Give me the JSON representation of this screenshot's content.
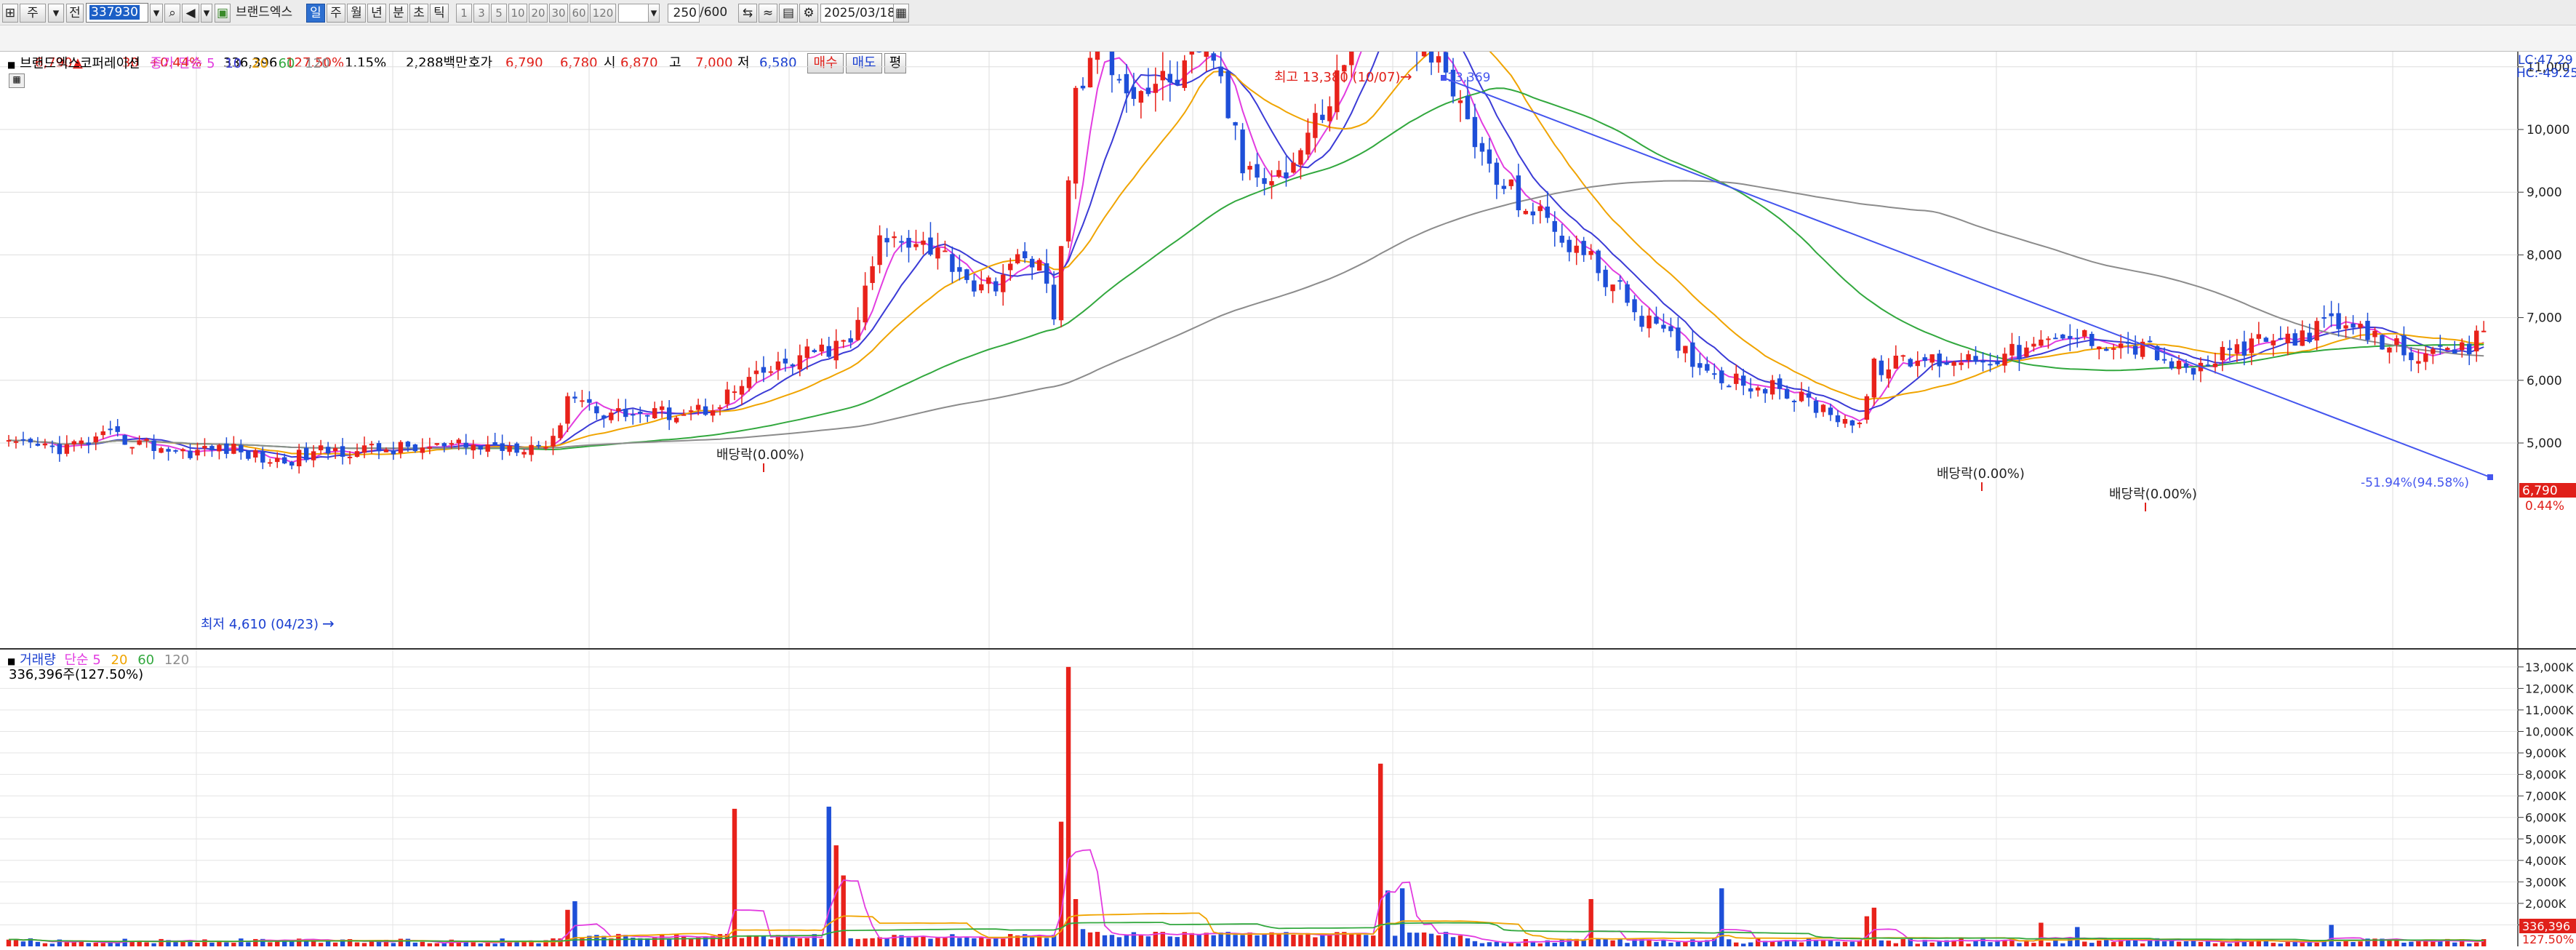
{
  "toolbar": {
    "type_selector": "주",
    "mode_selector": "전",
    "stock_code": "337930",
    "stock_name": "브랜드엑스",
    "period_tabs": [
      "일",
      "주",
      "월",
      "년",
      "분",
      "초",
      "틱"
    ],
    "active_period": "일",
    "interval_buttons": [
      "1",
      "3",
      "5",
      "10",
      "20",
      "30",
      "60",
      "120"
    ],
    "count_display": "250",
    "count_total": "/600",
    "date": "2025/03/18"
  },
  "quote": {
    "price": "6,790",
    "change_sign": "▲",
    "change": "30",
    "change_pct": "+0.44%",
    "volume": "336,396",
    "volume_ratio": "127.50%",
    "turnover": "1.15%",
    "trade_value": "2,288백만",
    "hoga_label": "호가",
    "ask": "6,790",
    "bid": "6,780",
    "open_label": "시",
    "open": "6,870",
    "high_label": "고",
    "high": "7,000",
    "low_label": "저",
    "low": "6,580",
    "buy_button": "매수",
    "sell_button": "매도",
    "eval_button": "평"
  },
  "price_panel": {
    "stock_label": "브랜드엑스코퍼레이션",
    "ma_label": "종가 단순",
    "ma_periods": [
      "5",
      "10",
      "20",
      "60",
      "120"
    ],
    "lc_label": "LC:47.29",
    "hc_label": "HC:-49.25",
    "current_price_tag": "6,790",
    "current_pct_tag": "0.44%",
    "high_annotation": "최고 13,380 (10/07)",
    "low_annotation": "최저 4,610 (04/23)",
    "trendline_start_label": "13,369",
    "trendline_end_label": "-51.94%(94.58%)",
    "dividend_labels": [
      "배당락(0.00%)",
      "배당락(0.00%)",
      "배당락(0.00%)"
    ]
  },
  "volume_panel": {
    "label": "거래량",
    "ma_label": "단순",
    "ma_periods": [
      "5",
      "20",
      "60",
      "120"
    ],
    "volume_value": "336,396주(127.50%)",
    "current_tag": "336,396",
    "current_tag2": "127.50%"
  },
  "colors": {
    "up": "#e8221b",
    "down": "#1e4fd8",
    "ma5": "#e23ce0",
    "ma10": "#3b3bd6",
    "ma20": "#f0a400",
    "ma60": "#32a83e",
    "ma120": "#8c8c8c",
    "trend": "#4455ee"
  },
  "chart_data": [
    {
      "type": "candlestick",
      "title": "브랜드엑스코퍼레이션",
      "ylim": [
        4500,
        13600
      ],
      "y_ticks": [
        5000,
        6000,
        7000,
        8000,
        9000,
        10000,
        11000,
        12000,
        13000
      ],
      "y_tick_labels": [
        "5,000",
        "6,000",
        "7,000",
        "8,000",
        "9,000",
        "10,000",
        "11,000",
        "12,000",
        "13,000"
      ],
      "y_scale": "linear",
      "grid": true,
      "high_point": {
        "date": "10/07",
        "price": 13380
      },
      "low_point": {
        "date": "04/23",
        "price": 4610
      },
      "last_price": 6790,
      "ma_series": [
        {
          "name": "5",
          "color": "#e23ce0"
        },
        {
          "name": "10",
          "color": "#3b3bd6"
        },
        {
          "name": "20",
          "color": "#f0a400"
        },
        {
          "name": "60",
          "color": "#32a83e"
        },
        {
          "name": "120",
          "color": "#8c8c8c"
        }
      ],
      "close_anchors": [
        [
          0,
          4950
        ],
        [
          8,
          4930
        ],
        [
          14,
          5100
        ],
        [
          24,
          4860
        ],
        [
          30,
          4920
        ],
        [
          37,
          4700
        ],
        [
          44,
          4880
        ],
        [
          52,
          4900
        ],
        [
          60,
          4930
        ],
        [
          68,
          4950
        ],
        [
          75,
          5000
        ],
        [
          77,
          5800
        ],
        [
          82,
          5500
        ],
        [
          88,
          5450
        ],
        [
          96,
          5550
        ],
        [
          104,
          6100
        ],
        [
          110,
          6400
        ],
        [
          116,
          6600
        ],
        [
          120,
          8200
        ],
        [
          125,
          8300
        ],
        [
          130,
          7900
        ],
        [
          134,
          7400
        ],
        [
          138,
          7800
        ],
        [
          142,
          8000
        ],
        [
          144,
          6900
        ],
        [
          147,
          10500
        ],
        [
          150,
          11400
        ],
        [
          155,
          10600
        ],
        [
          160,
          10800
        ],
        [
          166,
          11200
        ],
        [
          170,
          9400
        ],
        [
          176,
          9300
        ],
        [
          182,
          10500
        ],
        [
          189,
          12700
        ],
        [
          194,
          11500
        ],
        [
          200,
          10400
        ],
        [
          204,
          9300
        ],
        [
          210,
          8700
        ],
        [
          218,
          7900
        ],
        [
          226,
          6900
        ],
        [
          235,
          6100
        ],
        [
          245,
          5800
        ],
        [
          255,
          5300
        ],
        [
          257,
          6200
        ],
        [
          262,
          6300
        ],
        [
          275,
          6400
        ],
        [
          285,
          6700
        ],
        [
          295,
          6500
        ],
        [
          300,
          6100
        ],
        [
          307,
          6500
        ],
        [
          315,
          6700
        ],
        [
          320,
          6900
        ],
        [
          330,
          6500
        ],
        [
          334,
          6350
        ],
        [
          339,
          6500
        ],
        [
          341,
          6790
        ]
      ],
      "volume_max": 13000,
      "volume_ticks": [
        "1,000K",
        "2,000K",
        "3,000K",
        "4,000K",
        "5,000K",
        "6,000K",
        "7,000K",
        "8,000K",
        "9,000K",
        "10,000K",
        "11,000K",
        "12,000K",
        "13,000K"
      ],
      "volume_spikes": [
        [
          77,
          1700
        ],
        [
          78,
          2100
        ],
        [
          100,
          6400
        ],
        [
          113,
          6500
        ],
        [
          114,
          4700
        ],
        [
          115,
          3300
        ],
        [
          145,
          5800
        ],
        [
          146,
          13000
        ],
        [
          147,
          2200
        ],
        [
          189,
          8500
        ],
        [
          190,
          2600
        ],
        [
          192,
          2700
        ],
        [
          218,
          2200
        ],
        [
          236,
          2700
        ],
        [
          256,
          1400
        ],
        [
          257,
          1800
        ],
        [
          280,
          1100
        ],
        [
          285,
          900
        ],
        [
          320,
          1000
        ],
        [
          341,
          336
        ]
      ],
      "last_volume": 336396
    }
  ]
}
